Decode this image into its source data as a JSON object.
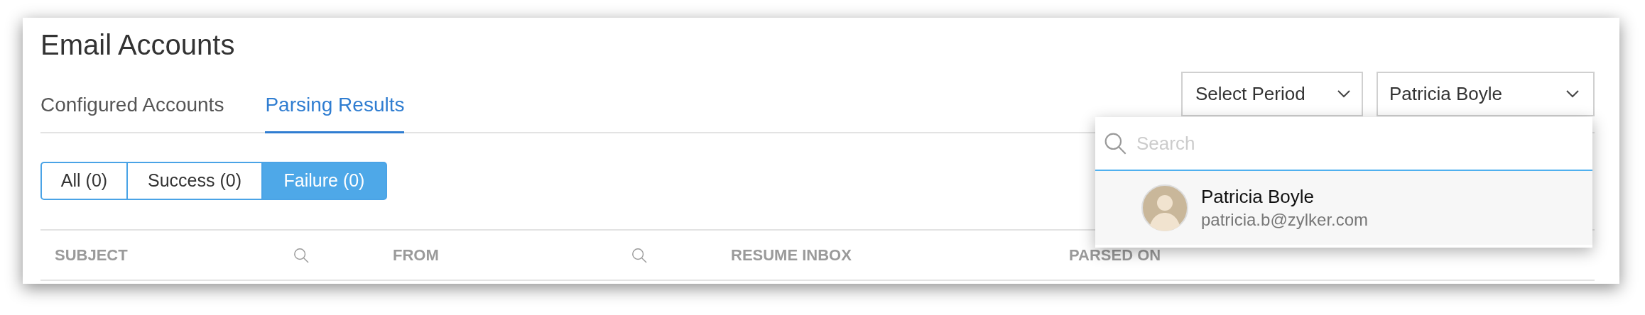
{
  "page": {
    "title": "Email Accounts"
  },
  "tabs": [
    {
      "label": "Configured Accounts",
      "selected": false
    },
    {
      "label": "Parsing Results",
      "selected": true
    }
  ],
  "filters": [
    {
      "label": "All (0)",
      "selected": false
    },
    {
      "label": "Success (0)",
      "selected": false
    },
    {
      "label": "Failure (0)",
      "selected": true
    }
  ],
  "period_select": {
    "value": "Select Period"
  },
  "user_select": {
    "value": "Patricia Boyle",
    "expanded": true
  },
  "user_dropdown": {
    "search": {
      "placeholder": "Search"
    },
    "users": [
      {
        "name": "Patricia Boyle",
        "email": "patricia.b@zylker.com"
      }
    ]
  },
  "table": {
    "columns": [
      {
        "label": "SUBJECT",
        "searchable": true
      },
      {
        "label": "FROM",
        "searchable": true
      },
      {
        "label": "RESUME INBOX",
        "searchable": false
      },
      {
        "label": "PARSED ON",
        "searchable": false
      }
    ]
  }
}
